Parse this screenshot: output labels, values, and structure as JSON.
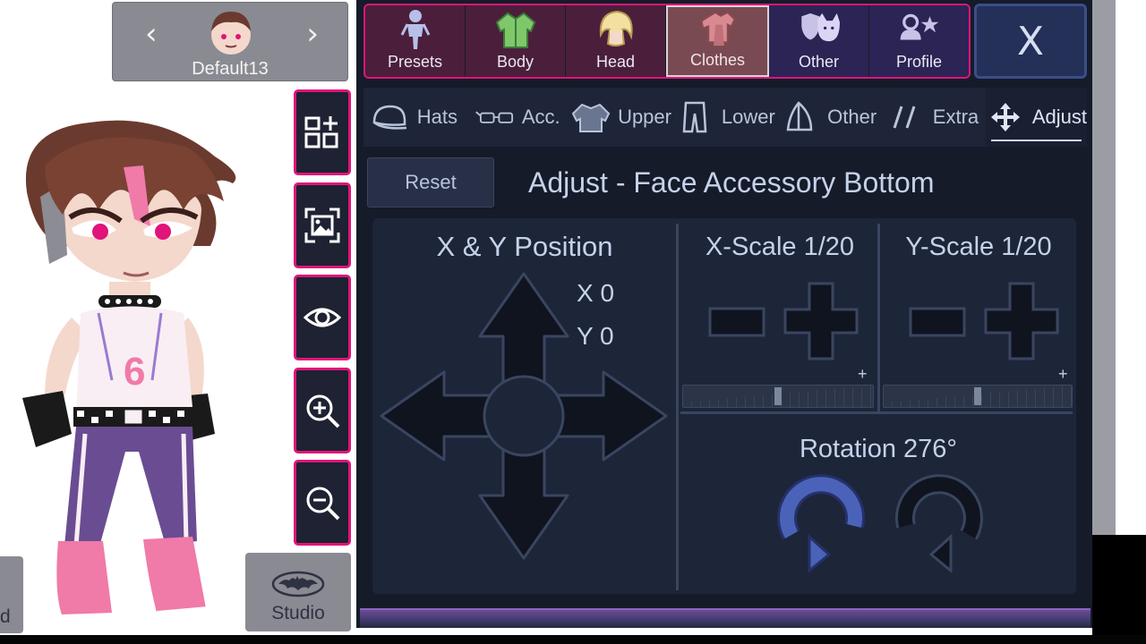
{
  "character_select": {
    "prev_glyph": "‹",
    "next_glyph": "›",
    "name": "Default13"
  },
  "side_buttons": [
    {
      "icon": "add-parts-icon"
    },
    {
      "icon": "screenshot-icon"
    },
    {
      "icon": "eye-icon"
    },
    {
      "icon": "zoom-in-icon"
    },
    {
      "icon": "zoom-out-icon"
    }
  ],
  "studio": {
    "label": "Studio",
    "icon": "batman-logo-icon"
  },
  "left_edge_label": "d",
  "main_tabs": [
    {
      "label": "Presets",
      "icon": "figure-icon"
    },
    {
      "label": "Body",
      "icon": "shirt-icon"
    },
    {
      "label": "Head",
      "icon": "hair-icon"
    },
    {
      "label": "Clothes",
      "icon": "clothes-icon",
      "active": true
    },
    {
      "label": "Other",
      "icon": "shield-cat-icon"
    },
    {
      "label": "Profile",
      "icon": "profile-star-icon"
    }
  ],
  "close_label": "X",
  "sub_tabs": [
    {
      "label": "Hats",
      "icon": "cap-icon"
    },
    {
      "label": "Acc.",
      "icon": "glasses-icon"
    },
    {
      "label": "Upper",
      "icon": "jacket-icon"
    },
    {
      "label": "Lower",
      "icon": "pants-icon"
    },
    {
      "label": "Other",
      "icon": "sail-icon"
    },
    {
      "label": "Extra",
      "icon": "slashes-icon"
    },
    {
      "label": "Adjust",
      "icon": "move-icon",
      "active": true
    }
  ],
  "adjust": {
    "reset_label": "Reset",
    "title": "Adjust - Face Accessory Bottom",
    "xy_title": "X & Y Position",
    "x_value": "X 0",
    "y_value": "Y 0",
    "x_scale_title": "X-Scale 1/20",
    "y_scale_title": "Y-Scale 1/20",
    "minus": "-",
    "plus": "+",
    "x_scale_level": 0.5,
    "y_scale_level": 0.5,
    "rotation_title": "Rotation 276°"
  },
  "colors": {
    "panel_bg": "#151b29",
    "accent_pink": "#e0147a",
    "tab_active": "#7a4a52",
    "rotate_blue": "#4a63b8"
  }
}
